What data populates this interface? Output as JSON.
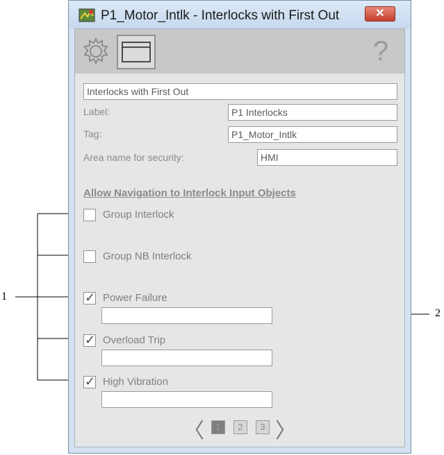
{
  "window": {
    "title": "P1_Motor_Intlk - Interlocks with First Out",
    "close_label": "✕"
  },
  "toolbar": {
    "gear_icon": "gear-icon",
    "display_icon": "window-icon",
    "help_label": "?"
  },
  "properties": {
    "description_value": "Interlocks with First Out",
    "label_caption": "Label:",
    "label_value": "P1 Interlocks",
    "tag_caption": "Tag:",
    "tag_value": "P1_Motor_Intlk",
    "area_caption": "Area name for security:",
    "area_value": "HMI"
  },
  "navigation": {
    "title": "Allow Navigation to Interlock Input Objects",
    "items": [
      {
        "label": "Group Interlock",
        "checked": false,
        "field_value": null
      },
      {
        "label": "Group NB Interlock",
        "checked": false,
        "field_value": null
      },
      {
        "label": "Power Failure",
        "checked": true,
        "field_value": ""
      },
      {
        "label": "Overload Trip",
        "checked": true,
        "field_value": ""
      },
      {
        "label": "High Vibration",
        "checked": true,
        "field_value": ""
      }
    ]
  },
  "pager": {
    "prev_label": "〈",
    "next_label": "〉",
    "pages": [
      "1",
      "2",
      "3"
    ],
    "current_page": "1"
  },
  "callouts": {
    "one": "1",
    "two": "2"
  },
  "colors": {
    "window_frame": "#d3e1f1",
    "panel_bg": "#e6e6e6",
    "toolbar_bg": "#c8c8c8",
    "close_button": "#c2402c"
  }
}
